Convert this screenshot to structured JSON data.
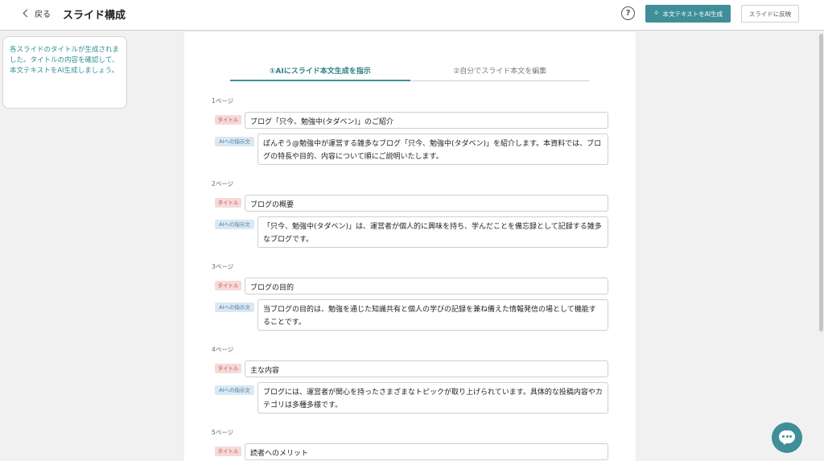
{
  "header": {
    "back_label": "戻る",
    "title": "スライド構成",
    "help_symbol": "?",
    "ai_button_label": "本文テキストをAI生成",
    "apply_button_label": "スライドに反映"
  },
  "info_message": "各スライドのタイトルが生成されました。タイトルの内容を確認して、本文テキストをAI生成しましょう。",
  "tabs": [
    {
      "label": "①AIにスライド本文生成を指示",
      "active": true
    },
    {
      "label": "②自分でスライド本文を編集",
      "active": false
    }
  ],
  "tag_labels": {
    "title": "タイトル",
    "prompt": "AIへの指示文"
  },
  "pages": [
    {
      "label": "1ページ",
      "title": "ブログ「只今、勉強中(タダベン)」のご紹介",
      "prompt": "ぽんぞう@勉強中が運営する雑多なブログ「只今、勉強中(タダベン)」を紹介します。本資料では、ブログの特長や目的、内容について順にご説明いたします。"
    },
    {
      "label": "2ページ",
      "title": "ブログの概要",
      "prompt": "「只今、勉強中(タダベン)」は、運営者が個人的に興味を持ち、学んだことを備忘録として記録する雑多なブログです。"
    },
    {
      "label": "3ページ",
      "title": "ブログの目的",
      "prompt": "当ブログの目的は、勉強を通じた知識共有と個人の学びの記録を兼ね備えた情報発信の場として機能することです。"
    },
    {
      "label": "4ページ",
      "title": "主な内容",
      "prompt": "ブログには、運営者が関心を持ったさまざまなトピックが取り上げられています。具体的な投稿内容やカテゴリは多種多様です。"
    },
    {
      "label": "5ページ",
      "title": "読者へのメリット",
      "prompt": ""
    }
  ],
  "colors": {
    "accent": "#3f8e98",
    "title_tag": "#f6d9d9",
    "prompt_tag": "#dbe8f2"
  }
}
